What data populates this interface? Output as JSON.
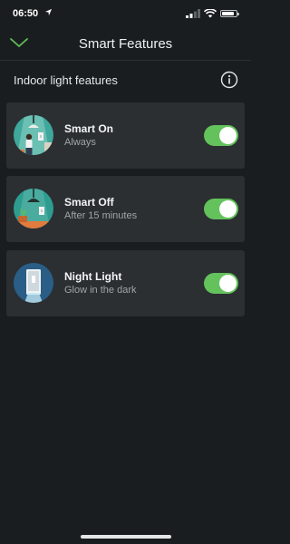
{
  "status": {
    "time": "06:50"
  },
  "nav": {
    "title": "Smart Features"
  },
  "section": {
    "title": "Indoor light features"
  },
  "features": [
    {
      "title": "Smart On",
      "subtitle": "Always",
      "enabled": true
    },
    {
      "title": "Smart Off",
      "subtitle": "After 15 minutes",
      "enabled": true
    },
    {
      "title": "Night Light",
      "subtitle": "Glow in the dark",
      "enabled": true
    }
  ],
  "colors": {
    "background": "#1a1d1f",
    "card": "#2b2f32",
    "toggle_on": "#64c25c",
    "accent": "#5fbf57"
  }
}
